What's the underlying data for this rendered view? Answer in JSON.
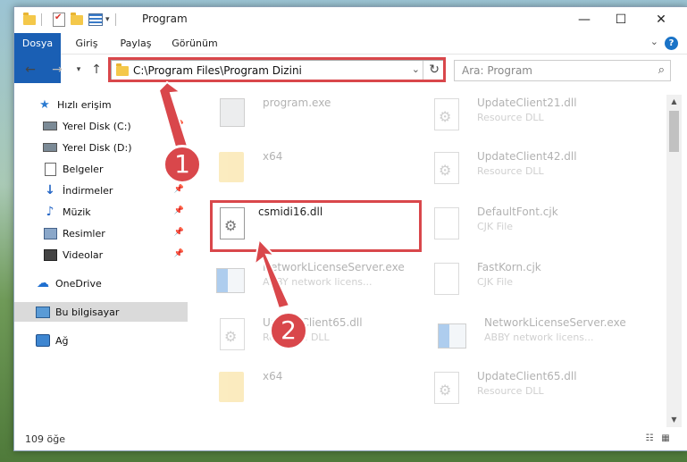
{
  "window": {
    "title": "Program",
    "controls": {
      "minimize": "—",
      "maximize": "☐",
      "close": "✕"
    }
  },
  "ribbon": {
    "tabs": [
      "Dosya",
      "Giriş",
      "Paylaş",
      "Görünüm"
    ],
    "help": "?",
    "collapse": "⌄"
  },
  "nav": {
    "back": "←",
    "forward": "→",
    "recent": "▾",
    "up": "↑"
  },
  "address": {
    "path": "C:\\Program Files\\Program Dizini",
    "dropdown": "⌄",
    "refresh": "↻"
  },
  "search": {
    "placeholder": "Ara: Program",
    "icon": "⌕"
  },
  "sidebar": {
    "items": [
      {
        "label": "Hızlı erişim",
        "icon": "star-icon",
        "pinned": false
      },
      {
        "label": "Yerel Disk (C:)",
        "icon": "drive-icon",
        "pinned": true
      },
      {
        "label": "Yerel Disk (D:)",
        "icon": "drive-icon",
        "pinned": false
      },
      {
        "label": "Belgeler",
        "icon": "document-icon",
        "pinned": true
      },
      {
        "label": "İndirmeler",
        "icon": "download-icon",
        "pinned": true
      },
      {
        "label": "Müzik",
        "icon": "music-icon",
        "pinned": true
      },
      {
        "label": "Resimler",
        "icon": "pictures-icon",
        "pinned": true
      },
      {
        "label": "Videolar",
        "icon": "video-icon",
        "pinned": true
      },
      {
        "label": "OneDrive",
        "icon": "onedrive-icon",
        "pinned": false
      },
      {
        "label": "Bu bilgisayar",
        "icon": "computer-icon",
        "pinned": false,
        "selected": true
      },
      {
        "label": "Ağ",
        "icon": "network-icon",
        "pinned": false
      }
    ],
    "pin_glyph": "📌"
  },
  "files": [
    {
      "name": "program.exe",
      "desc": "",
      "icon": "program-exe-icon",
      "faded": true
    },
    {
      "name": "UpdateClient21.dll",
      "desc": "Resource DLL",
      "icon": "dll-icon",
      "faded": true
    },
    {
      "name": "x64",
      "desc": "",
      "icon": "folder-icon",
      "faded": true
    },
    {
      "name": "UpdateClient42.dll",
      "desc": "Resource DLL",
      "icon": "dll-icon",
      "faded": true
    },
    {
      "name": "csmidi16.dll",
      "desc": "",
      "icon": "dll-icon",
      "faded": false
    },
    {
      "name": "DefaultFont.cjk",
      "desc": "CJK File",
      "icon": "cjk-file-icon",
      "faded": true
    },
    {
      "name": "NetworkLicenseServer.exe",
      "desc": "ABBY network licens...",
      "icon": "exe-icon",
      "faded": true
    },
    {
      "name": "FastKorn.cjk",
      "desc": "CJK File",
      "icon": "cjk-file-icon",
      "faded": true
    },
    {
      "name": "UpdateClient65.dll",
      "desc": "Resource DLL",
      "icon": "dll-icon",
      "faded": true
    },
    {
      "name": "NetworkLicenseServer.exe",
      "desc": "ABBY network licens...",
      "icon": "exe-icon",
      "faded": true
    },
    {
      "name": "x64",
      "desc": "",
      "icon": "folder-icon",
      "faded": true
    },
    {
      "name": "UpdateClient65.dll",
      "desc": "Resource DLL",
      "icon": "dll-icon",
      "faded": true
    }
  ],
  "status": {
    "count": "109 öğe"
  },
  "callouts": [
    "1",
    "2"
  ],
  "colors": {
    "highlight": "#d9474b",
    "accent": "#1a5fb4"
  }
}
